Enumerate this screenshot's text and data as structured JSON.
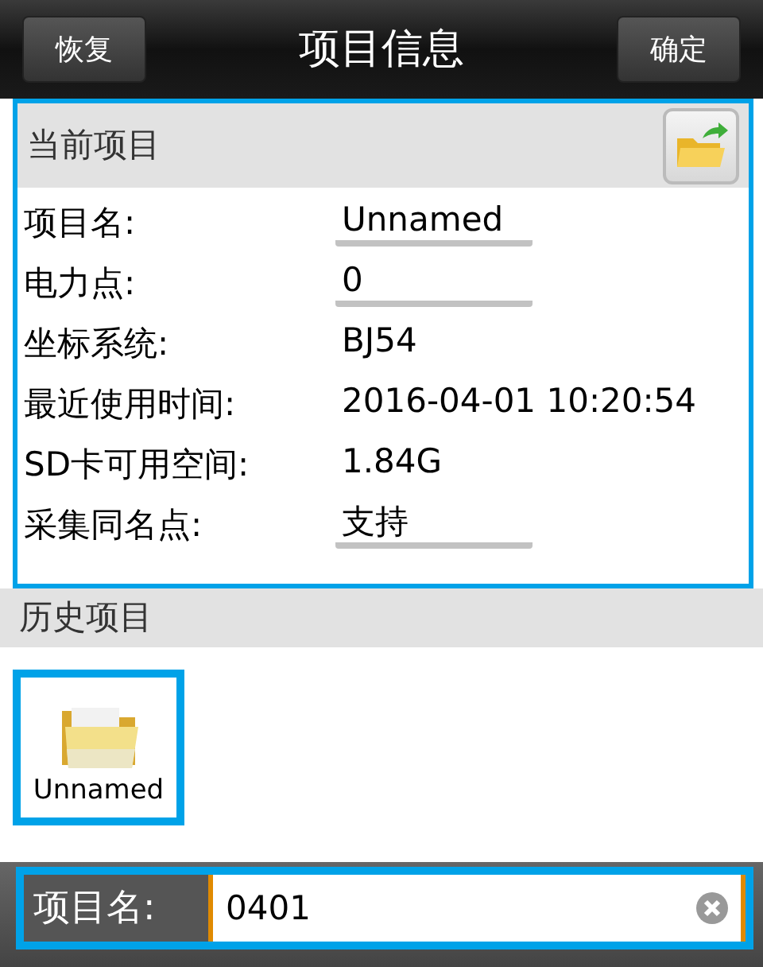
{
  "header": {
    "left_button": "恢复",
    "title": "项目信息",
    "right_button": "确定"
  },
  "current_project": {
    "title": "当前项目",
    "highlighted": true,
    "fields": [
      {
        "label": "项目名:",
        "value": "Unnamed",
        "editable": true
      },
      {
        "label": "电力点:",
        "value": "0",
        "editable": true
      },
      {
        "label": "坐标系统:",
        "value": "BJ54",
        "editable": false
      },
      {
        "label": "最近使用时间:",
        "value": "2016-04-01 10:20:54",
        "editable": false
      },
      {
        "label": "SD卡可用空间:",
        "value": "1.84G",
        "editable": false
      },
      {
        "label": "采集同名点:",
        "value": "支持",
        "editable": true
      }
    ]
  },
  "history": {
    "title": "历史项目",
    "items": [
      {
        "name": "Unnamed",
        "selected": true
      }
    ]
  },
  "bottom_input": {
    "label": "项目名:",
    "value": "0401",
    "focused": true
  }
}
